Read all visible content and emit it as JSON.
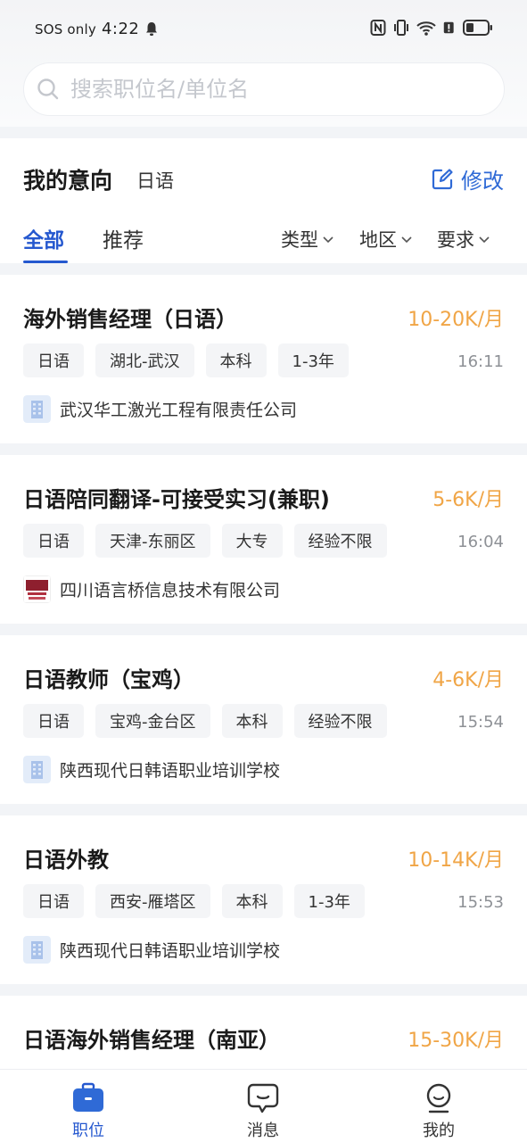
{
  "status_bar": {
    "carrier": "SOS only",
    "time": "4:22"
  },
  "search": {
    "placeholder": "搜索职位名/单位名",
    "value": ""
  },
  "intent": {
    "title": "我的意向",
    "value": "日语",
    "edit_label": "修改"
  },
  "tabs": [
    {
      "label": "全部",
      "active": true
    },
    {
      "label": "推荐",
      "active": false
    }
  ],
  "filters": [
    {
      "label": "类型"
    },
    {
      "label": "地区"
    },
    {
      "label": "要求"
    }
  ],
  "jobs": [
    {
      "title": "海外销售经理（日语）",
      "salary": "10-20K/月",
      "tags": [
        "日语",
        "湖北-武汉",
        "本科",
        "1-3年"
      ],
      "time": "16:11",
      "company": "武汉华工激光工程有限责任公司",
      "logo": "building-icon"
    },
    {
      "title": "日语陪同翻译-可接受实习(兼职)",
      "salary": "5-6K/月",
      "tags": [
        "日语",
        "天津-东丽区",
        "大专",
        "经验不限"
      ],
      "time": "16:04",
      "company": "四川语言桥信息技术有限公司",
      "logo": "company-logo-image"
    },
    {
      "title": "日语教师（宝鸡）",
      "salary": "4-6K/月",
      "tags": [
        "日语",
        "宝鸡-金台区",
        "本科",
        "经验不限"
      ],
      "time": "15:54",
      "company": "陕西现代日韩语职业培训学校",
      "logo": "building-icon"
    },
    {
      "title": "日语外教",
      "salary": "10-14K/月",
      "tags": [
        "日语",
        "西安-雁塔区",
        "本科",
        "1-3年"
      ],
      "time": "15:53",
      "company": "陕西现代日韩语职业培训学校",
      "logo": "building-icon"
    },
    {
      "title": "日语海外销售经理（南亚）",
      "salary": "15-30K/月",
      "tags": [],
      "time": "",
      "company": "",
      "logo": ""
    }
  ],
  "bottom_nav": [
    {
      "label": "职位",
      "icon": "briefcase-icon",
      "active": true
    },
    {
      "label": "消息",
      "icon": "message-icon",
      "active": false
    },
    {
      "label": "我的",
      "icon": "user-icon",
      "active": false
    }
  ],
  "colors": {
    "accent": "#2558cf",
    "salary": "#f0a546",
    "link": "#2f6ad6"
  }
}
